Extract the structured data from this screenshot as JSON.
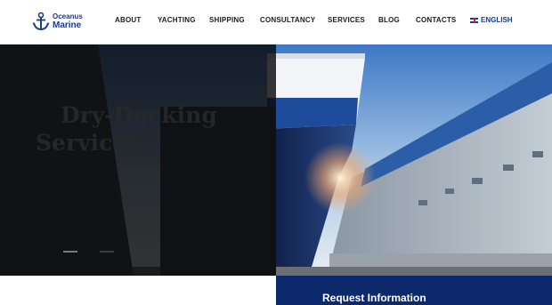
{
  "brand": {
    "line1": "Oceanus",
    "line2": "Marine"
  },
  "nav": [
    {
      "label": "ABOUT"
    },
    {
      "label": "YACHTING"
    },
    {
      "label": "SHIPPING"
    },
    {
      "label": "CONSULTANCY"
    },
    {
      "label": "SERVICES"
    },
    {
      "label": "BLOG"
    },
    {
      "label": "CONTACTS"
    }
  ],
  "language": {
    "label": "ENGLISH",
    "flag_icon": "uk-flag-icon"
  },
  "hero": {
    "title_line1": "Dry-Docking",
    "title_line2": "Services"
  },
  "cta": {
    "label": "Request Information"
  },
  "colors": {
    "brand_blue": "#1b3a8a",
    "cta_bg": "#0c2a6b",
    "overlay": "#0a0a0a"
  }
}
